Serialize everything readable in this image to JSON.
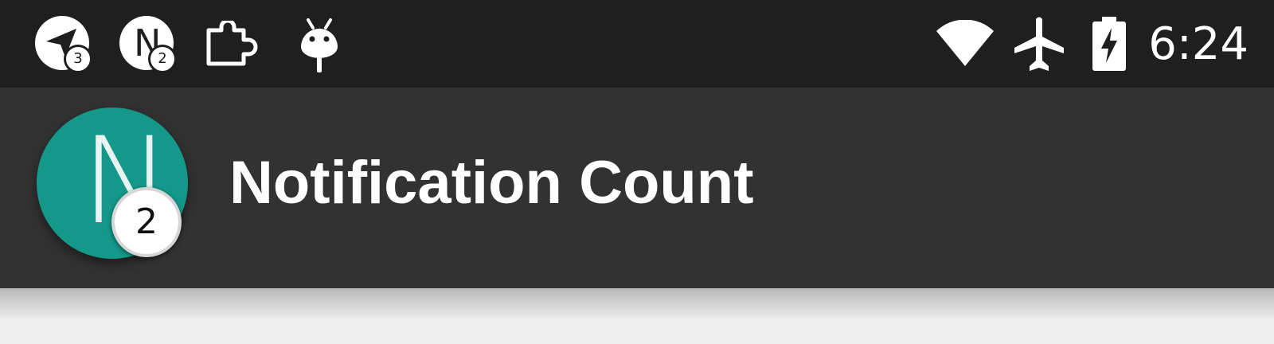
{
  "status_bar": {
    "notifications": [
      {
        "icon": "send-icon",
        "badge": "3"
      },
      {
        "icon": "letter-n-icon",
        "letter": "N",
        "badge": "2"
      },
      {
        "icon": "puzzle-icon"
      },
      {
        "icon": "android-icon"
      }
    ],
    "system_icons": [
      "wifi-icon",
      "airplane-icon",
      "battery-charging-icon"
    ],
    "time": "6:24"
  },
  "toolbar": {
    "app_icon": {
      "letter": "N",
      "badge": "2",
      "color": "#14988a"
    },
    "title": "Notification Count"
  },
  "colors": {
    "status_bar": "#1f1f1f",
    "toolbar": "#323232",
    "background": "#efefef",
    "accent": "#14988a"
  }
}
